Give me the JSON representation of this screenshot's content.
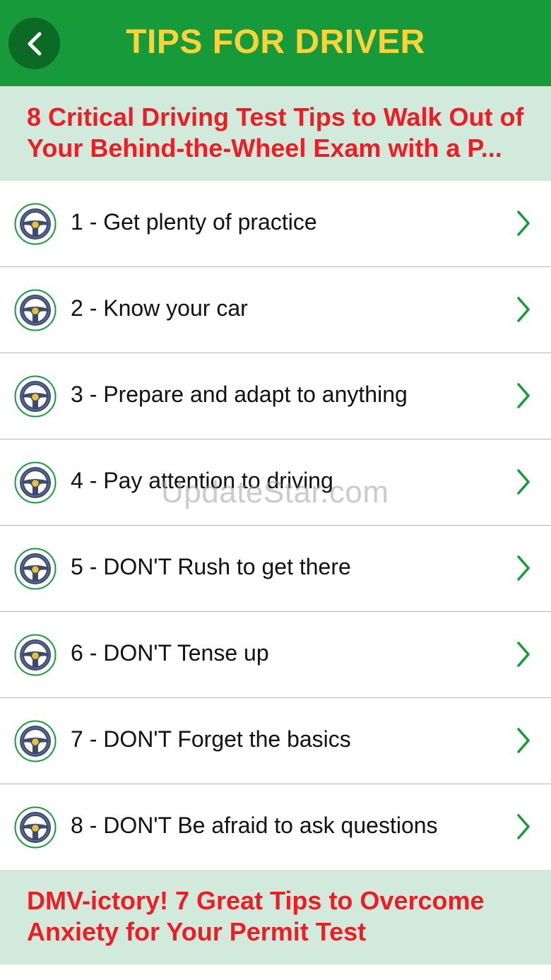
{
  "navbar": {
    "title": "TIPS FOR DRIVER",
    "back_icon": "chevron-left-icon"
  },
  "section1": {
    "line1": "8 Critical Driving Test Tips to Walk Out of",
    "line2": "Your Behind-the-Wheel Exam with a P..."
  },
  "items": [
    {
      "label": "1 - Get plenty of practice"
    },
    {
      "label": "2 - Know your car"
    },
    {
      "label": "3 - Prepare and adapt to anything"
    },
    {
      "label": "4 - Pay attention to driving"
    },
    {
      "label": "5 - DON'T Rush to get there"
    },
    {
      "label": "6 - DON'T Tense up"
    },
    {
      "label": "7 - DON'T Forget the basics"
    },
    {
      "label": "8 - DON'T Be afraid to ask questions"
    }
  ],
  "section2": {
    "line1": "DMV-ictory! 7 Great Tips to Overcome",
    "line2": "Anxiety for Your Permit Test"
  },
  "watermark": "UpdateStar.com",
  "colors": {
    "navbar_bg": "#169a3a",
    "title": "#ffd23a",
    "header_bg": "#d2eadb",
    "header_text": "#ee1c25",
    "accent": "#169a3a"
  },
  "icons": {
    "row_icon": "steering-wheel-icon",
    "row_chevron": "chevron-right-icon"
  }
}
